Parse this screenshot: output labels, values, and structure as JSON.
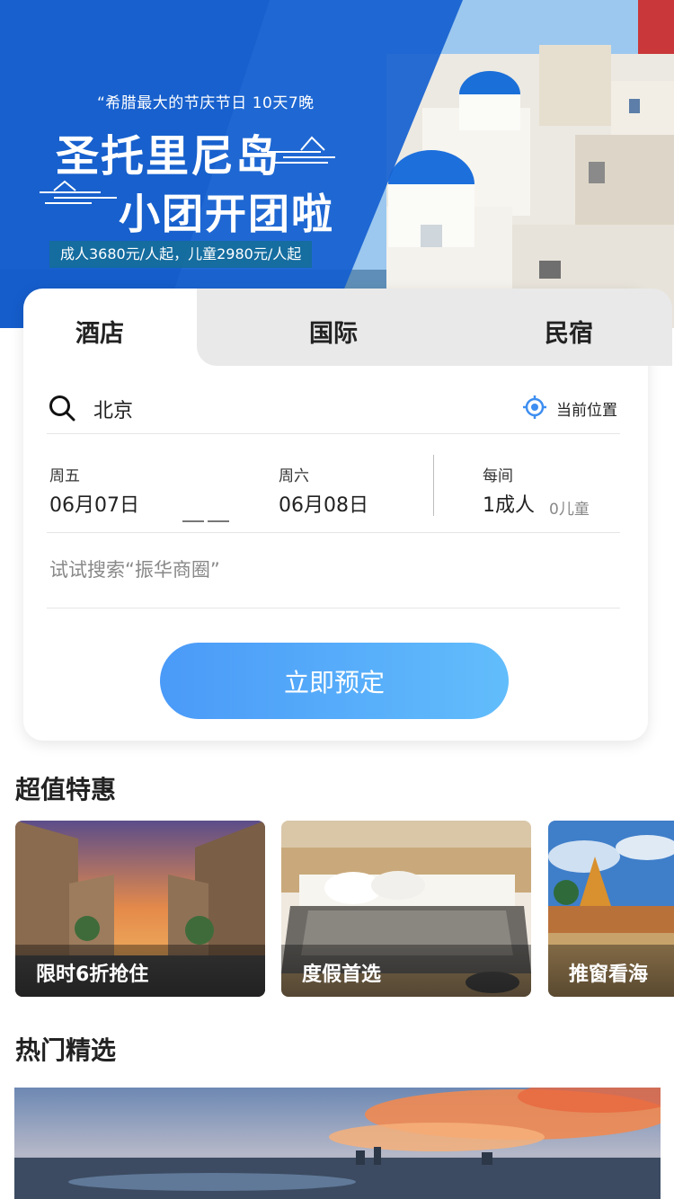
{
  "banner": {
    "subtitle": "“希腊最大的节庆节日 10天7晚",
    "title_line1": "圣托里尼岛",
    "title_line2": "小团开团啦",
    "price": "成人3680元/人起，儿童2980元/人起"
  },
  "tabs": [
    {
      "label": "酒店"
    },
    {
      "label": "国际"
    },
    {
      "label": "民宿"
    }
  ],
  "search": {
    "destination": "北京",
    "current_location": "当前位置",
    "checkin_day": "周五",
    "checkin_date": "06月07日",
    "checkout_day": "周六",
    "checkout_date": "06月08日",
    "room_label": "每间",
    "adults": "1成人",
    "children": "0儿童",
    "keyword_placeholder": "试试搜索“振华商圈”",
    "book_button": "立即预定"
  },
  "deals": {
    "title": "超值特惠",
    "items": [
      {
        "label": "限时6折抢住"
      },
      {
        "label": "度假首选"
      },
      {
        "label": "推窗看海"
      }
    ]
  },
  "hot": {
    "title": "热门精选"
  },
  "colors": {
    "accent_blue": "#4a9af8",
    "accent_blue_light": "#62bdfb",
    "banner_blue": "#1560d0",
    "tab_inactive_bg": "#e9e9e9"
  },
  "icons": [
    "search-icon",
    "location-target-icon"
  ]
}
